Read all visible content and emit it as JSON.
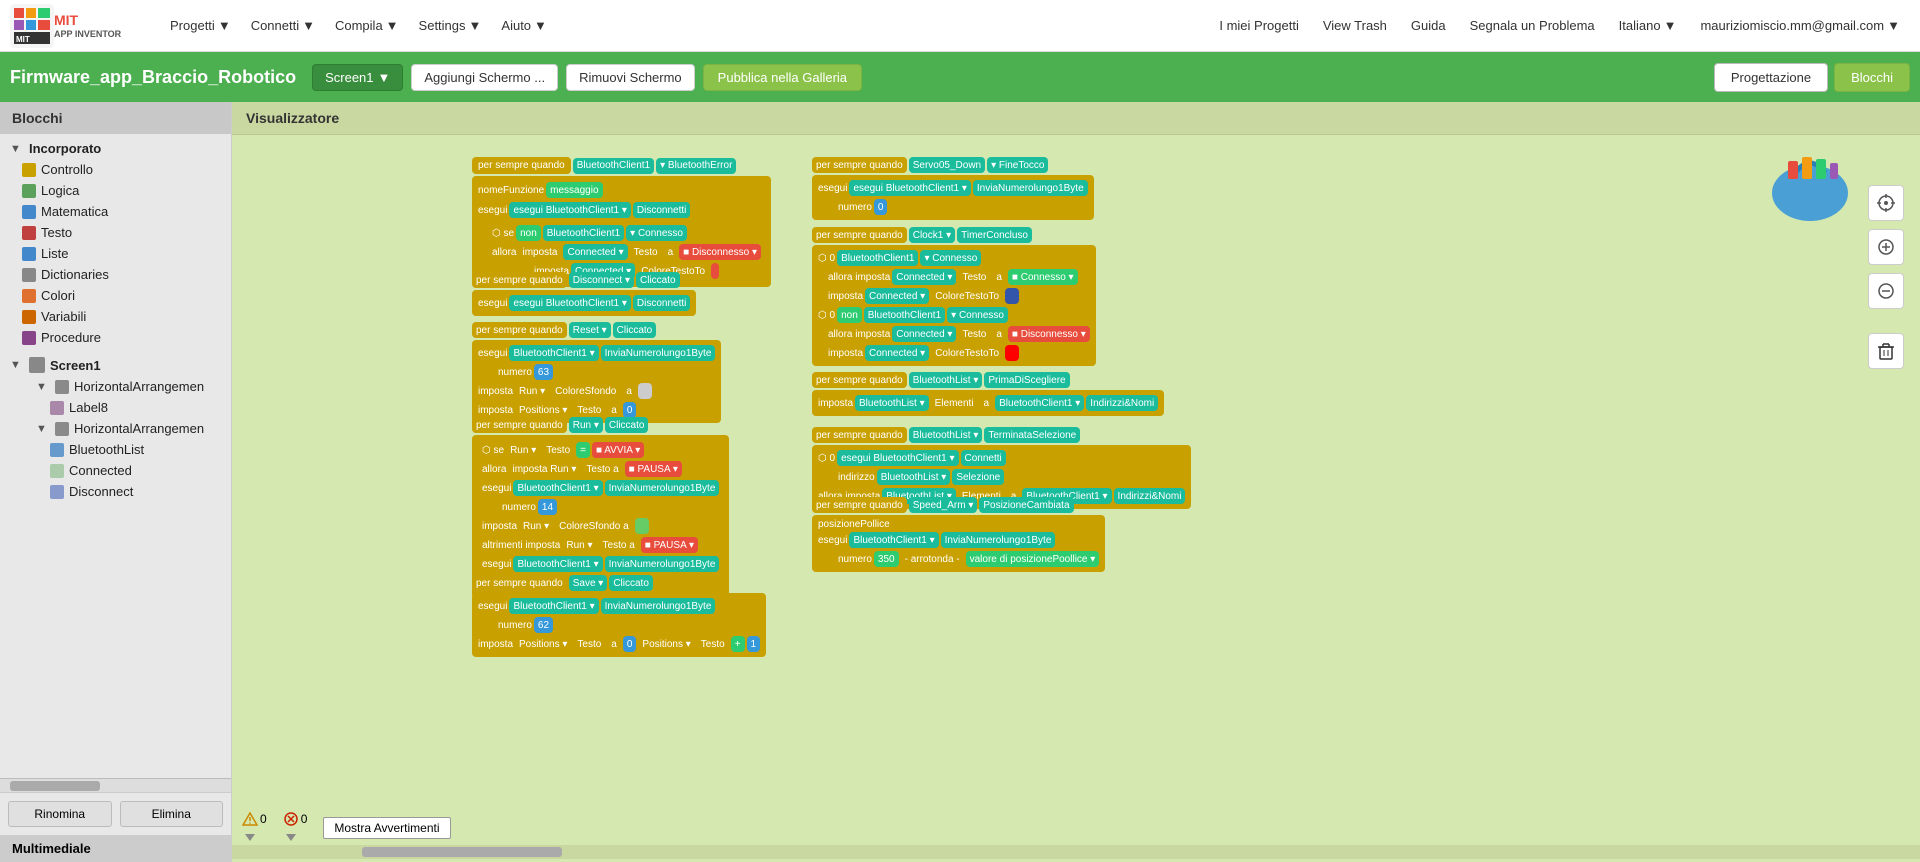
{
  "nav": {
    "logo_line1": "MIT",
    "logo_line2": "APP INVENTOR",
    "items": [
      {
        "label": "Progetti",
        "id": "progetti"
      },
      {
        "label": "Connetti",
        "id": "connetti"
      },
      {
        "label": "Compila",
        "id": "compila"
      },
      {
        "label": "Settings",
        "id": "settings"
      },
      {
        "label": "Aiuto",
        "id": "aiuto"
      }
    ],
    "right_items": [
      {
        "label": "I miei Progetti",
        "id": "miei-progetti"
      },
      {
        "label": "View Trash",
        "id": "view-trash"
      },
      {
        "label": "Guida",
        "id": "guida"
      },
      {
        "label": "Segnala un Problema",
        "id": "segnala"
      },
      {
        "label": "Italiano",
        "id": "italiano"
      },
      {
        "label": "mauriziomiscio.mm@gmail.com",
        "id": "user-email"
      }
    ]
  },
  "second_bar": {
    "project_title": "Firmware_app_Braccio_Robotico",
    "screen_btn": "Screen1",
    "add_screen_btn": "Aggiungi Schermo ...",
    "remove_screen_btn": "Rimuovi Schermo",
    "publish_btn": "Pubblica nella Galleria",
    "design_btn": "Progettazione",
    "blocks_btn": "Blocchi"
  },
  "sidebar": {
    "title": "Blocchi",
    "sections": {
      "incorporato": "Incorporato",
      "items": [
        {
          "label": "Controllo",
          "color": "#c8a000",
          "indent": 1
        },
        {
          "label": "Logica",
          "color": "#5ba05b",
          "indent": 1
        },
        {
          "label": "Matematica",
          "color": "#4488cc",
          "indent": 1
        },
        {
          "label": "Testo",
          "color": "#c04040",
          "indent": 1
        },
        {
          "label": "Liste",
          "color": "#4488cc",
          "indent": 1
        },
        {
          "label": "Dictionaries",
          "color": "#888888",
          "indent": 1
        },
        {
          "label": "Colori",
          "color": "#e07030",
          "indent": 1
        },
        {
          "label": "Variabili",
          "color": "#cc6600",
          "indent": 1
        },
        {
          "label": "Procedure",
          "color": "#884488",
          "indent": 1
        }
      ],
      "screen1": "Screen1",
      "screen1_items": [
        {
          "label": "HorizontalArrangemen",
          "indent": 2,
          "expandable": true
        },
        {
          "label": "Label8",
          "indent": 3
        },
        {
          "label": "HorizontalArrangemen",
          "indent": 2,
          "expandable": true
        },
        {
          "label": "BluetoothList",
          "indent": 3
        },
        {
          "label": "Connected",
          "indent": 3
        },
        {
          "label": "Disconnect",
          "indent": 3
        }
      ]
    },
    "rename_btn": "Rinomina",
    "delete_btn": "Elimina",
    "footer": "Multimediale"
  },
  "canvas": {
    "title": "Visualizzatore",
    "warnings": {
      "warning_count": "0",
      "error_count": "0",
      "show_btn": "Mostra Avvertimenti"
    }
  },
  "controls": {
    "crosshair": "⊕",
    "zoom_in": "+",
    "zoom_out": "−",
    "trash": "🗑"
  }
}
